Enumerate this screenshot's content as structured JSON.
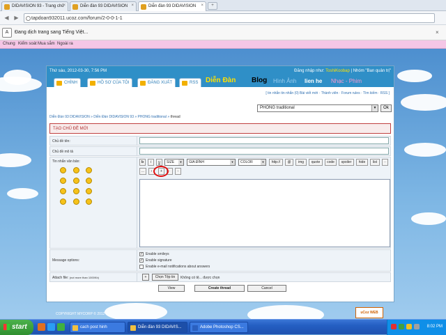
{
  "browser": {
    "tabs": [
      {
        "label": "DIDAVISION 93 - Trang chủ"
      },
      {
        "label": "Diễn đàn 93 DIDAVISION"
      },
      {
        "label": "Diễn đàn 93 DIDAVISION",
        "active": true
      }
    ],
    "url": "tapdoan932011.ucoz.com/forum/2-0-0-1-1",
    "translate_text": "Đang dịch trang sang Tiếng Việt...",
    "bookmarks": [
      "Chung",
      "Kiểm soát",
      "Mua sắm",
      "Ngoài ra"
    ]
  },
  "header": {
    "date": "Thứ sáu, 2012-03-30, 7:56 PM",
    "login_prefix": "Đăng nhập như: ",
    "username": "ToshiKoobap",
    "group": " | Nhóm \"Ban quản trị\"",
    "tabs": [
      "CHÍNH",
      "HỒ SƠ CỦA TÔI",
      "ĐĂNG XUẤT",
      "RSS"
    ],
    "nav": {
      "forum": "Diễn Đàn",
      "blog": "Blog",
      "images": "Hình Ảnh",
      "contact": "lien he",
      "music": "Nhạc - Phim"
    }
  },
  "top_links": "[ tin nhắn tin nhắn (0) Bài viết mới · Thành viên · Forum rules · Tìm kiếm · RSS ]",
  "jump": {
    "value": "PHONG traditional",
    "ok": "Ok"
  },
  "breadcrumb": {
    "path": "Diễn Đàn 93 DIDAVISION » Diễn Đàn DIDAVISION 93 » PHONG traditional » ",
    "current": "thread"
  },
  "form": {
    "title": "TẠO CHỦ ĐỀ MỚI",
    "subject_label": "Chủ đề tên:",
    "desc_label": "Chủ đề mô tả",
    "message_label": "Tin nhắn văn bản:",
    "toolbar": {
      "bold": "b",
      "italic": "i",
      "underline": "u",
      "size": "SIZE",
      "font": "GIA ĐÌNH",
      "color": "COLOR",
      "buttons": [
        "http://",
        "@",
        "img",
        "quote",
        "code",
        "spoiler",
        "hide",
        "list"
      ],
      "row2": [
        "...",
        "+",
        "·",
        "-"
      ]
    },
    "options_label": "Message options:",
    "options": [
      {
        "label": "Enable smileys",
        "checked": true
      },
      {
        "label": "Enable signature",
        "checked": true
      },
      {
        "label": "Enable e-mail notifications about answers",
        "checked": false
      }
    ],
    "attach_label": "Attach file:",
    "attach_note": "(not more than 1000Kb)",
    "attach_add": "+",
    "choose_file": "Chọn Tệp tin",
    "no_file": "Không có tệ... được chọn",
    "view": "View",
    "create": "Create thread",
    "cancel": "Cancel"
  },
  "footer": {
    "copyright": "COPYRIGHT MYCORP © 2012",
    "ucoz": "uCoz WEB"
  },
  "taskbar": {
    "start": "start",
    "items": [
      {
        "label": "cach post hinh"
      },
      {
        "label": "Diễn đàn 93 DIDAVIS...",
        "active": true
      },
      {
        "label": "Adobe Photoshop CS..."
      }
    ],
    "clock": "8:02 PM"
  }
}
